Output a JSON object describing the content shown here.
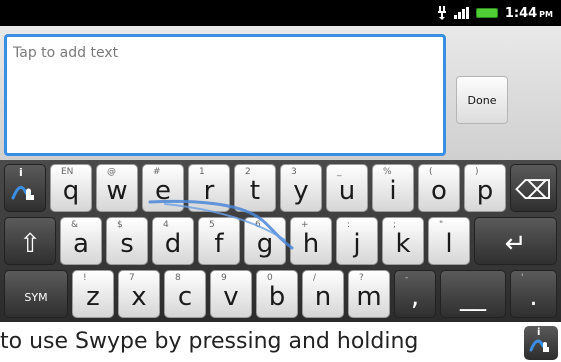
{
  "statusbar": {
    "time": "1:44",
    "ampm": "PM"
  },
  "editor": {
    "placeholder": "Tap to add text",
    "value": ""
  },
  "done_button": {
    "label": "Done"
  },
  "keyboard": {
    "row1": [
      {
        "id": "swype",
        "label": "",
        "sub": ""
      },
      {
        "id": "q",
        "label": "q",
        "sub": "EN"
      },
      {
        "id": "w",
        "label": "w",
        "sub": "@"
      },
      {
        "id": "e",
        "label": "e",
        "sub": "#"
      },
      {
        "id": "r",
        "label": "r",
        "sub": "1"
      },
      {
        "id": "t",
        "label": "t",
        "sub": "2"
      },
      {
        "id": "y",
        "label": "y",
        "sub": "3"
      },
      {
        "id": "u",
        "label": "u",
        "sub": "_"
      },
      {
        "id": "i",
        "label": "i",
        "sub": "%"
      },
      {
        "id": "o",
        "label": "o",
        "sub": "("
      },
      {
        "id": "p",
        "label": "p",
        "sub": ")"
      },
      {
        "id": "backspace",
        "label": "⌫",
        "sub": ""
      }
    ],
    "row2": [
      {
        "id": "shift",
        "label": "⇧",
        "sub": ""
      },
      {
        "id": "a",
        "label": "a",
        "sub": "&"
      },
      {
        "id": "s",
        "label": "s",
        "sub": "$"
      },
      {
        "id": "d",
        "label": "d",
        "sub": "4"
      },
      {
        "id": "f",
        "label": "f",
        "sub": "5"
      },
      {
        "id": "g",
        "label": "g",
        "sub": "6"
      },
      {
        "id": "h",
        "label": "h",
        "sub": "+"
      },
      {
        "id": "j",
        "label": "j",
        "sub": ":"
      },
      {
        "id": "k",
        "label": "k",
        "sub": ";"
      },
      {
        "id": "l",
        "label": "l",
        "sub": "\""
      },
      {
        "id": "enter",
        "label": "↵",
        "sub": ""
      }
    ],
    "row3": [
      {
        "id": "sym",
        "label": "SYM",
        "sub": ""
      },
      {
        "id": "z",
        "label": "z",
        "sub": "!"
      },
      {
        "id": "x",
        "label": "x",
        "sub": "7"
      },
      {
        "id": "c",
        "label": "c",
        "sub": "8"
      },
      {
        "id": "v",
        "label": "v",
        "sub": "9"
      },
      {
        "id": "b",
        "label": "b",
        "sub": "0"
      },
      {
        "id": "n",
        "label": "n",
        "sub": "/"
      },
      {
        "id": "m",
        "label": "m",
        "sub": "?"
      },
      {
        "id": "comma",
        "label": ",",
        "sub": "-"
      },
      {
        "id": "space",
        "label": "__",
        "sub": ""
      },
      {
        "id": "period",
        "label": ".",
        "sub": "'"
      }
    ]
  },
  "help": {
    "text": "r to use Swype by pressing and holding"
  },
  "colors": {
    "accent": "#3a8fe4",
    "battery": "#4fcf35",
    "trace": "#4a86d6"
  },
  "icons": [
    "usb-debug-icon",
    "signal-icon",
    "battery-icon",
    "swype-logo-icon"
  ]
}
